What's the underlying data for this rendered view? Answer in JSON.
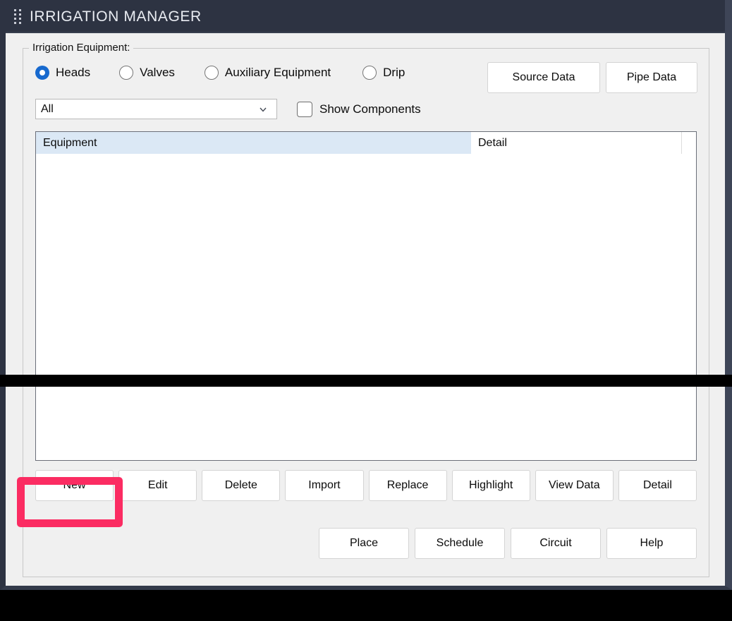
{
  "window": {
    "title": "IRRIGATION MANAGER",
    "grip_icon": "grip-dots-icon",
    "titlebar_color": "#2d3342"
  },
  "group": {
    "legend": "Irrigation Equipment:"
  },
  "equipment_types": {
    "selected": "Heads",
    "options": [
      {
        "label": "Heads",
        "checked": true
      },
      {
        "label": "Valves",
        "checked": false
      },
      {
        "label": "Auxiliary Equipment",
        "checked": false
      },
      {
        "label": "Drip",
        "checked": false
      }
    ]
  },
  "data_buttons": [
    {
      "label": "Source Data"
    },
    {
      "label": "Pipe Data"
    }
  ],
  "filter": {
    "select_value": "All",
    "select_icon": "chevron-down-icon",
    "checkbox": {
      "label": "Show Components",
      "checked": false
    }
  },
  "list": {
    "columns": [
      {
        "label": "Equipment",
        "highlighted": true
      },
      {
        "label": "Detail",
        "highlighted": false
      }
    ],
    "rows": []
  },
  "action_buttons": [
    {
      "label": "New",
      "highlighted": true
    },
    {
      "label": "Edit",
      "highlighted": false
    },
    {
      "label": "Delete",
      "highlighted": false
    },
    {
      "label": "Import",
      "highlighted": false
    },
    {
      "label": "Replace",
      "highlighted": false
    },
    {
      "label": "Highlight",
      "highlighted": false
    },
    {
      "label": "View Data",
      "highlighted": false
    },
    {
      "label": "Detail",
      "highlighted": false
    }
  ],
  "footer_buttons": [
    {
      "label": "Place"
    },
    {
      "label": "Schedule"
    },
    {
      "label": "Circuit"
    },
    {
      "label": "Help"
    }
  ],
  "annotation": {
    "target": "New",
    "color": "#fb2c62"
  }
}
